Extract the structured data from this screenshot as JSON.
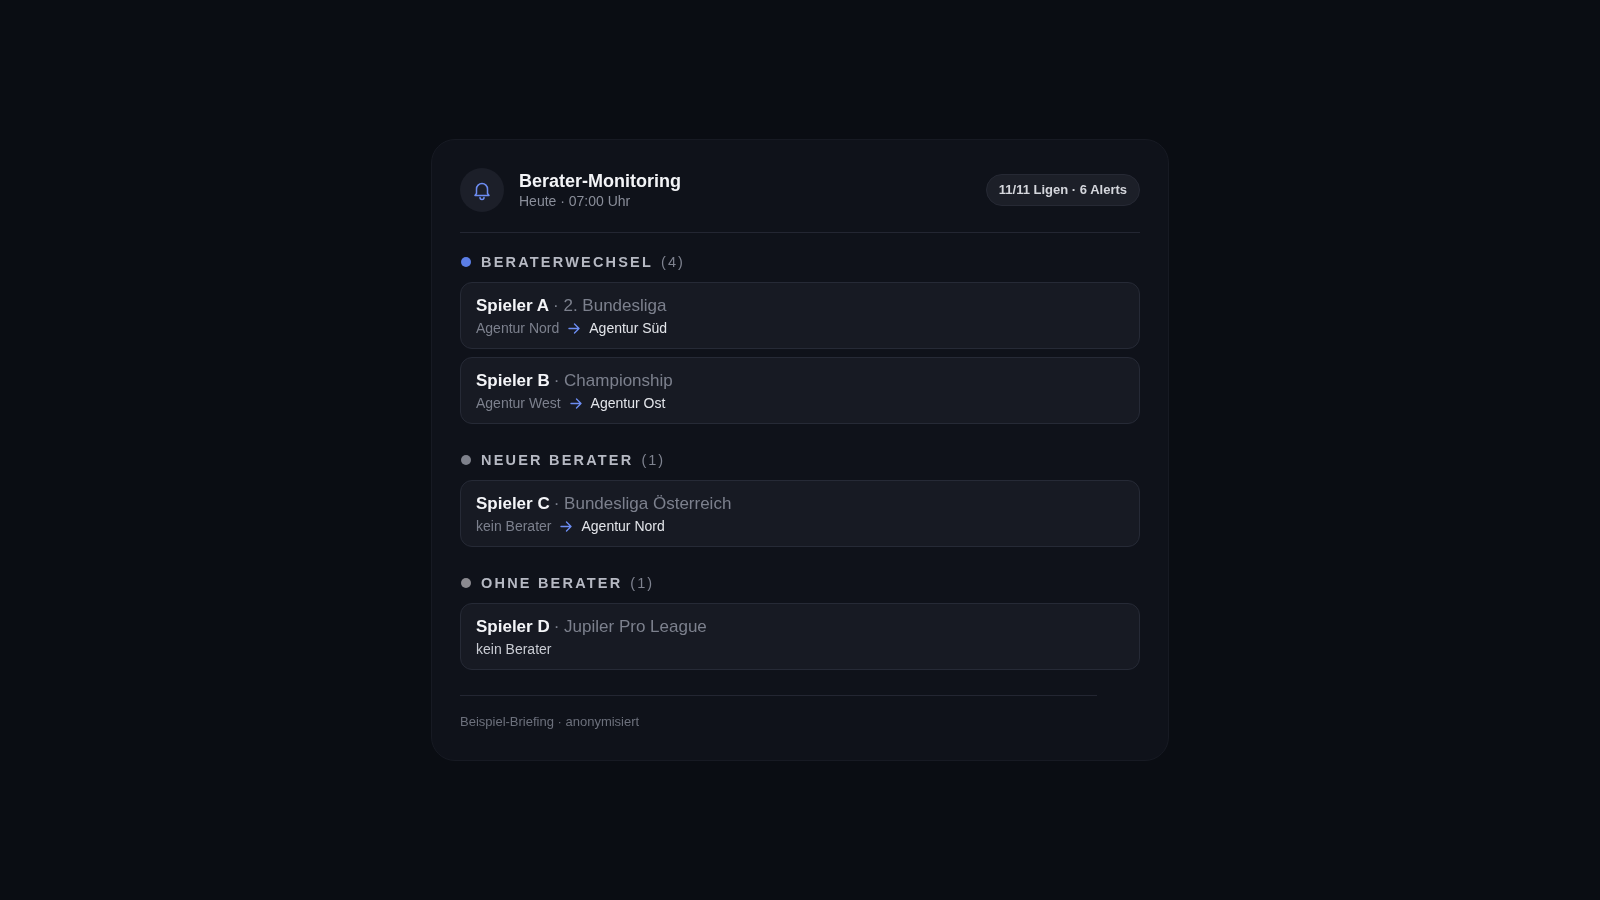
{
  "header": {
    "title": "Berater-Monitoring",
    "subtitle": "Heute · 07:00 Uhr",
    "badge": "11/11 Ligen · 6 Alerts"
  },
  "sections": [
    {
      "label": "BERATERWECHSEL",
      "count": "(4)",
      "color": "#5b7ee6",
      "items": [
        {
          "kind": "transfer",
          "player": "Spieler A",
          "league": "· 2. Bundesliga",
          "from": "Agentur Nord",
          "to": "Agentur Süd"
        },
        {
          "kind": "transfer",
          "player": "Spieler B",
          "league": "· Championship",
          "from": "Agentur West",
          "to": "Agentur Ost"
        }
      ]
    },
    {
      "label": "NEUER BERATER",
      "count": "(1)",
      "color": "#7e818b",
      "items": [
        {
          "kind": "transfer",
          "player": "Spieler C",
          "league": "· Bundesliga Österreich",
          "from": "kein Berater",
          "to": "Agentur Nord"
        }
      ]
    },
    {
      "label": "OHNE BERATER",
      "count": "(1)",
      "color": "#8b8a90",
      "items": [
        {
          "kind": "status",
          "player": "Spieler D",
          "league": "· Jupiler Pro League",
          "status": "kein Berater"
        }
      ]
    }
  ],
  "footer": "Beispiel-Briefing · anonymisiert"
}
